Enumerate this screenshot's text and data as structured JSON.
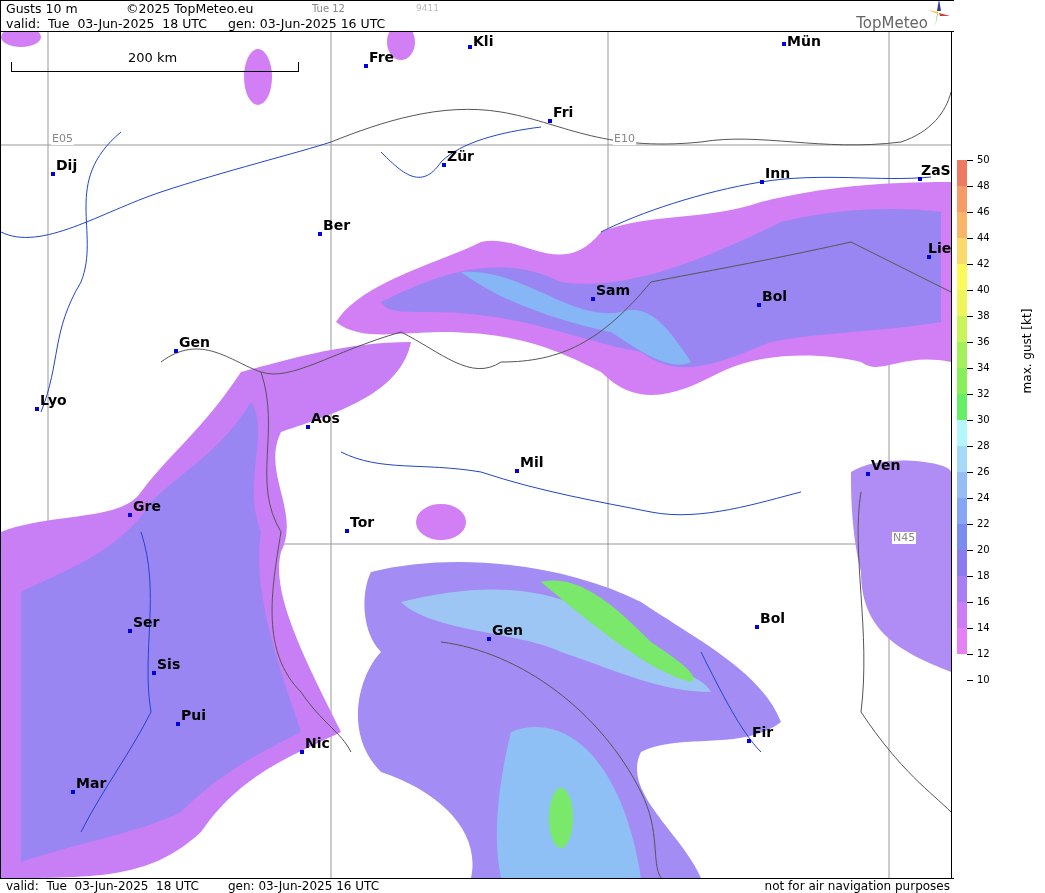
{
  "header": {
    "title": "Gusts 10 m",
    "copyright": "©2025 TopMeteo.eu",
    "run_label": "Tue 12",
    "code": "9411",
    "valid": "valid:  Tue  03-Jun-2025  18 UTC",
    "generated": "gen: 03-Jun-2025 16 UTC",
    "logo_text": "TopMeteo"
  },
  "map": {
    "scale_label": "200 km",
    "grid_labels": [
      "E05",
      "E10",
      "N45"
    ],
    "cities": [
      {
        "name": "Kli"
      },
      {
        "name": "Mün"
      },
      {
        "name": "Fre"
      },
      {
        "name": "Fri"
      },
      {
        "name": "Dij"
      },
      {
        "name": "Zür"
      },
      {
        "name": "Inn"
      },
      {
        "name": "ZaS"
      },
      {
        "name": "Ber"
      },
      {
        "name": "Lie"
      },
      {
        "name": "Sam"
      },
      {
        "name": "Bol"
      },
      {
        "name": "Gen"
      },
      {
        "name": "Lyo"
      },
      {
        "name": "Aos"
      },
      {
        "name": "Mil"
      },
      {
        "name": "Ven"
      },
      {
        "name": "Gre"
      },
      {
        "name": "Tor"
      },
      {
        "name": "Ser"
      },
      {
        "name": "Gen"
      },
      {
        "name": "Bol"
      },
      {
        "name": "Sis"
      },
      {
        "name": "Pui"
      },
      {
        "name": "Fir"
      },
      {
        "name": "Nic"
      },
      {
        "name": "Mar"
      }
    ]
  },
  "legend": {
    "title": "max. gust [kt]",
    "ticks": [
      "50",
      "48",
      "46",
      "44",
      "42",
      "40",
      "38",
      "36",
      "34",
      "32",
      "30",
      "28",
      "26",
      "24",
      "22",
      "20",
      "18",
      "16",
      "14",
      "12",
      "10"
    ],
    "bands": [
      {
        "color": "#ee7a62"
      },
      {
        "color": "#f69a66"
      },
      {
        "color": "#f9b56a"
      },
      {
        "color": "#fbd96a"
      },
      {
        "color": "#fafa5a"
      },
      {
        "color": "#eef55a"
      },
      {
        "color": "#c8f45a"
      },
      {
        "color": "#a4f05a"
      },
      {
        "color": "#88ee5a"
      },
      {
        "color": "#66ee66"
      },
      {
        "color": "#b4f6fb"
      },
      {
        "color": "#a6d8f8"
      },
      {
        "color": "#96bef5"
      },
      {
        "color": "#86a6f5"
      },
      {
        "color": "#7a8cf0"
      },
      {
        "color": "#8a7cf0"
      },
      {
        "color": "#a97ef5"
      },
      {
        "color": "#cc7df5"
      },
      {
        "color": "#e680f5"
      }
    ]
  },
  "footer": {
    "valid": "valid:  Tue  03-Jun-2025  18 UTC",
    "generated": "gen: 03-Jun-2025 16 UTC",
    "disclaimer": "not for air navigation purposes"
  }
}
